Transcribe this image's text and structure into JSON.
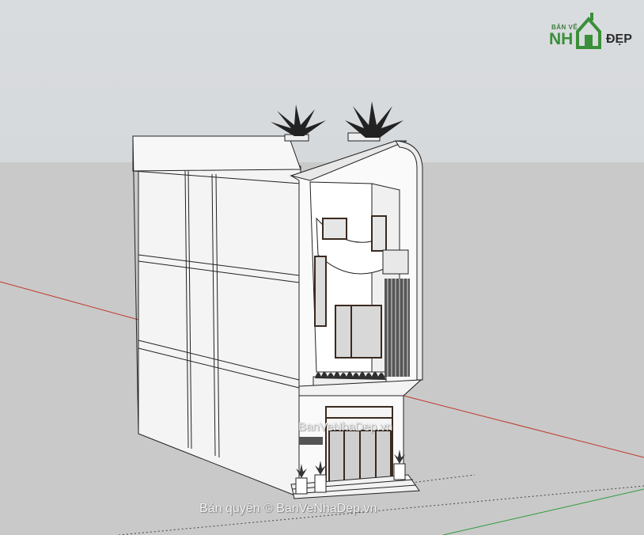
{
  "viewport": {
    "sky_color": "#d7dadd",
    "ground_color": "#c9c9c9",
    "axis_colors": {
      "red": "#c0392b",
      "green": "#2e9b3e",
      "blue_dotted": "#333333"
    }
  },
  "logo": {
    "top_text": "BẢN VẼ",
    "main_text": "NH",
    "suffix_text": "ĐẸP",
    "icon": "house-icon"
  },
  "watermarks": {
    "center": "BanVeNhaDep.vn",
    "bottom": "Bản quyền © BanVeNhaDep.vn"
  },
  "model": {
    "name_icon": "townhouse-3d-model",
    "plants_icon": "palm-plant-icon"
  }
}
